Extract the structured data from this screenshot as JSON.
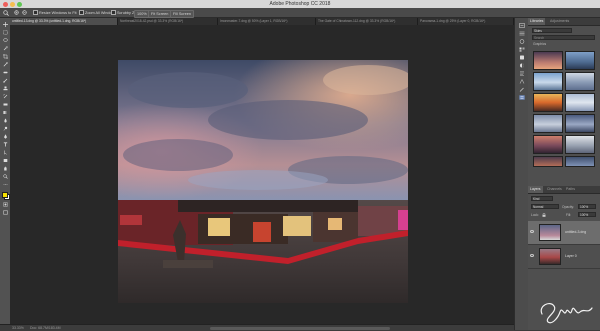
{
  "app": {
    "window_title": "Adobe Photoshop CC 2018"
  },
  "options_bar": {
    "resize_windows_label": "Resize Windows to Fit",
    "zoom_all_windows_label": "Zoom All Windows",
    "scrubby_zoom_label": "Scrubby Zoom",
    "zoom_level": "100%",
    "fit_screen_label": "Fit Screen",
    "fill_screen_label": "Fill Screen"
  },
  "tabs": [
    {
      "label": "untitled-13.dng @ 33.3% (untitled-1.dng, RGB/16*)",
      "active": true
    },
    {
      "label": "Northeast2018-42.psd @ 33.3% (RGB/16*)",
      "active": false
    },
    {
      "label": "Imonmaster-7.dng @ 50% (Layer 1, RGB/16*)",
      "active": false
    },
    {
      "label": "The Gate of Chinatown-112.dng @ 33.3% (RGB/16*)",
      "active": false
    },
    {
      "label": "Panorama-1.dng @ 25% (Layer 0, RGB/16*)",
      "active": false
    }
  ],
  "status_bar": {
    "zoom": "33.33%",
    "doc_info": "Doc: 68.7M/183.4M"
  },
  "libraries_panel": {
    "tabs": [
      "Libraries",
      "Adjustments"
    ],
    "library_name": "Skies",
    "search_placeholder": "Search",
    "section_label": "Graphics"
  },
  "layers_panel": {
    "tabs": [
      "Layers",
      "Channels",
      "Paths"
    ],
    "kind_label": "Kind",
    "blend_mode": "Normal",
    "opacity_label": "Opacity:",
    "opacity_value": "100%",
    "lock_label": "Lock:",
    "fill_label": "Fill:",
    "fill_value": "100%",
    "layers": [
      {
        "name": "untitled-3.dng"
      },
      {
        "name": "Layer 0"
      }
    ]
  },
  "watermark": {
    "signature_text": "Sm"
  },
  "colors": {
    "foreground": "#f5e000",
    "background": "#ffffff"
  },
  "icons": [
    "zoom-icon",
    "move-tool-icon",
    "marquee-tool-icon",
    "lasso-tool-icon",
    "brush-tool-icon",
    "eraser-tool-icon",
    "text-tool-icon",
    "hand-tool-icon",
    "history-icon",
    "properties-icon",
    "libraries-icon",
    "layers-icon",
    "eye-icon",
    "lock-icon"
  ]
}
